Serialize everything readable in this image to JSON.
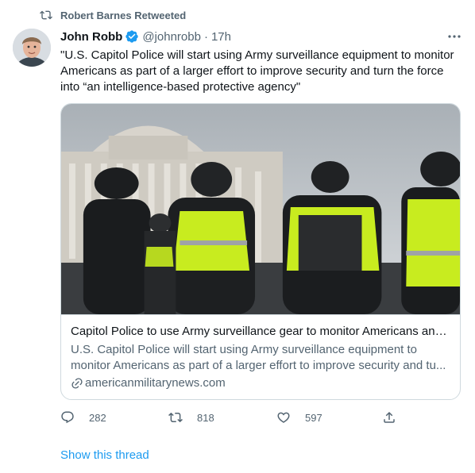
{
  "retweet": {
    "text": "Robert Barnes Retweeted",
    "icon": "retweet-icon"
  },
  "author": {
    "name": "John Robb",
    "handle": "@johnrobb",
    "separator": "·",
    "time": "17h",
    "verified_color": "#1d9bf0"
  },
  "tweet": {
    "text": "\"U.S. Capitol Police will start using Army surveillance equipment to monitor Americans as part of a larger effort to improve security and turn the force into “an intelligence-based protective agency\""
  },
  "card": {
    "title": "Capitol Police to use Army surveillance gear to monitor Americans and...",
    "description": "U.S. Capitol Police will start using Army surveillance equipment to monitor Americans as part of a larger effort to improve security and tu...",
    "domain": "americanmilitarynews.com"
  },
  "actions": {
    "replies": "282",
    "retweets": "818",
    "likes": "597"
  },
  "show_thread": "Show this thread",
  "colors": {
    "accent": "#1d9bf0",
    "secondary_text": "#536471",
    "vest": "#c8ec1f"
  }
}
